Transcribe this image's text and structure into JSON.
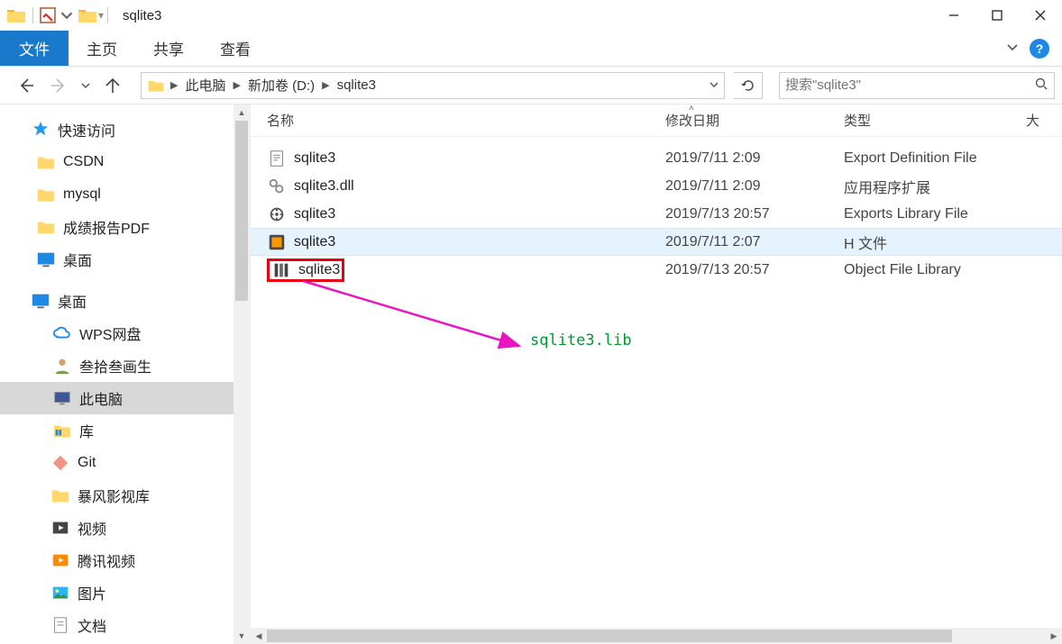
{
  "title": "sqlite3",
  "ribbon": {
    "file": "文件",
    "tabs": [
      "主页",
      "共享",
      "查看"
    ]
  },
  "breadcrumb": {
    "items": [
      "此电脑",
      "新加卷 (D:)",
      "sqlite3"
    ]
  },
  "search": {
    "placeholder": "搜索\"sqlite3\""
  },
  "columns": {
    "name": "名称",
    "date": "修改日期",
    "type": "类型",
    "size": "大"
  },
  "tree": {
    "quick_access": "快速访问",
    "quick_items": [
      "CSDN",
      "mysql",
      "成绩报告PDF",
      "桌面"
    ],
    "desktop": "桌面",
    "desktop_items": [
      {
        "label": "WPS网盘",
        "icon": "cloud"
      },
      {
        "label": "叁拾叁画生",
        "icon": "user"
      },
      {
        "label": "此电脑",
        "icon": "pc",
        "selected": true
      },
      {
        "label": "库",
        "icon": "lib"
      }
    ],
    "lib_items": [
      {
        "label": "Git",
        "icon": "git"
      },
      {
        "label": "暴风影视库",
        "icon": "folder"
      },
      {
        "label": "视频",
        "icon": "video"
      },
      {
        "label": "腾讯视频",
        "icon": "tx"
      },
      {
        "label": "图片",
        "icon": "pic"
      },
      {
        "label": "文档",
        "icon": "doc"
      }
    ]
  },
  "files": [
    {
      "name": "sqlite3",
      "date": "2019/7/11 2:09",
      "type": "Export Definition File",
      "icon": "def"
    },
    {
      "name": "sqlite3.dll",
      "date": "2019/7/11 2:09",
      "type": "应用程序扩展",
      "icon": "dll"
    },
    {
      "name": "sqlite3",
      "date": "2019/7/13 20:57",
      "type": "Exports Library File",
      "icon": "exp"
    },
    {
      "name": "sqlite3",
      "date": "2019/7/11 2:07",
      "type": "H 文件",
      "icon": "h",
      "hover": true
    },
    {
      "name": "sqlite3",
      "date": "2019/7/13 20:57",
      "type": "Object File Library",
      "icon": "lib",
      "boxed": true
    }
  ],
  "annotation": "sqlite3.lib"
}
